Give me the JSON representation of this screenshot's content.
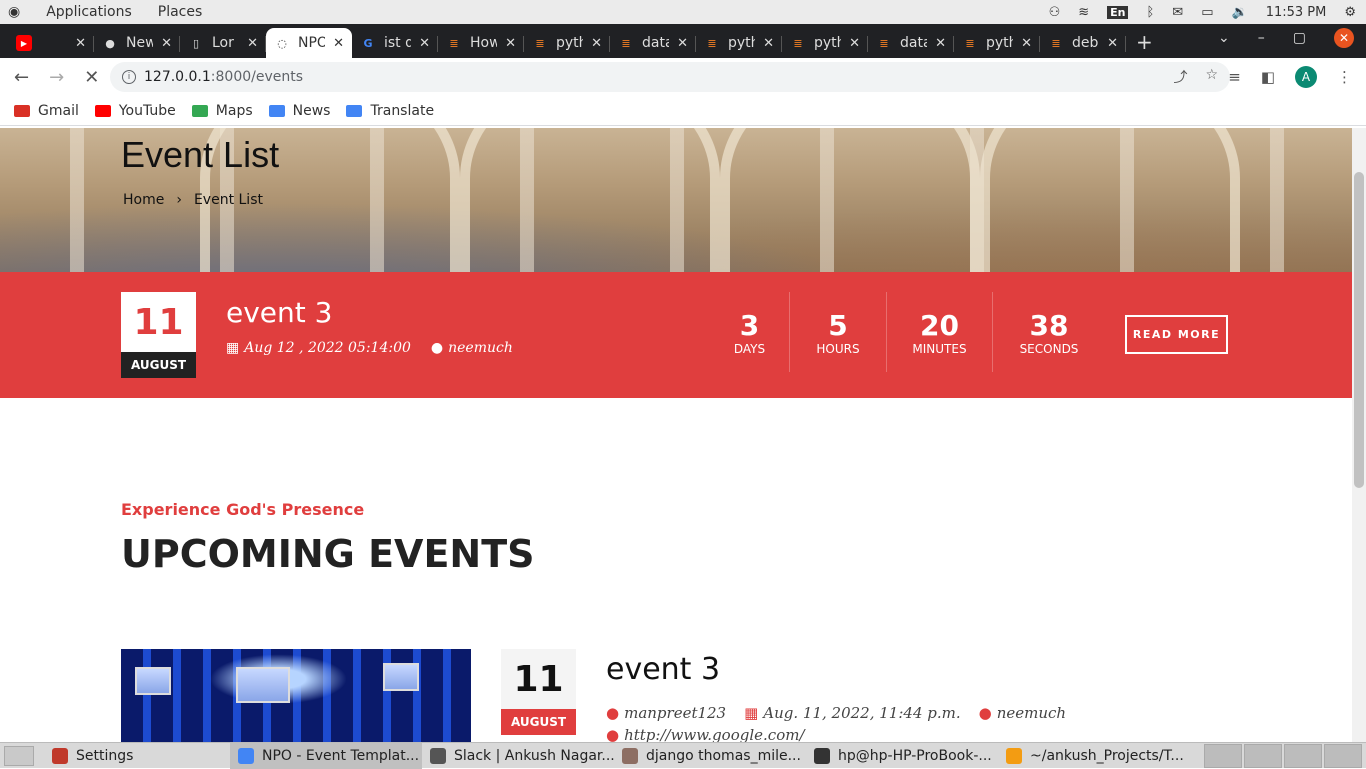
{
  "topbar": {
    "applications": "Applications",
    "places": "Places",
    "lang": "En",
    "time": "11:53 PM"
  },
  "tabs": [
    {
      "title": "",
      "icon": "youtube-icon",
      "color": "#ff0000"
    },
    {
      "title": "New",
      "icon": "github-icon"
    },
    {
      "title": "Lor",
      "icon": "page-icon"
    },
    {
      "title": "NPO",
      "icon": "loading-icon",
      "active": true
    },
    {
      "title": "ist d",
      "icon": "google-icon"
    },
    {
      "title": "How",
      "icon": "stackoverflow-icon"
    },
    {
      "title": "pyth",
      "icon": "stackoverflow-icon"
    },
    {
      "title": "data",
      "icon": "stackoverflow-icon"
    },
    {
      "title": "pyth",
      "icon": "stackoverflow-icon"
    },
    {
      "title": "pyth",
      "icon": "stackoverflow-icon"
    },
    {
      "title": "data",
      "icon": "stackoverflow-icon"
    },
    {
      "title": "pyth",
      "icon": "stackoverflow-icon"
    },
    {
      "title": "deb",
      "icon": "stackoverflow-icon"
    }
  ],
  "url": {
    "host": "127.0.0.1",
    "path": ":8000/events"
  },
  "avatar_letter": "A",
  "bookmarks": [
    {
      "label": "Gmail",
      "color": "#d93025"
    },
    {
      "label": "YouTube",
      "color": "#ff0000"
    },
    {
      "label": "Maps",
      "color": "#34a853"
    },
    {
      "label": "News",
      "color": "#4285f4"
    },
    {
      "label": "Translate",
      "color": "#4285f4"
    }
  ],
  "hero": {
    "title": "Event List",
    "crumb_home": "Home",
    "crumb_sep": "›",
    "crumb_current": "Event List"
  },
  "featured": {
    "day": "11",
    "month": "AUGUST",
    "title": "event 3",
    "date": "Aug 12 , 2022 05:14:00",
    "location": "neemuch",
    "countdown": [
      {
        "value": "3",
        "unit": "DAYS"
      },
      {
        "value": "5",
        "unit": "HOURS"
      },
      {
        "value": "20",
        "unit": "MINUTES"
      },
      {
        "value": "38",
        "unit": "SECONDS"
      }
    ],
    "read_more": "READ MORE"
  },
  "section": {
    "tagline": "Experience God's Presence",
    "heading": "UPCOMING EVENTS"
  },
  "event_card": {
    "day": "11",
    "month": "AUGUST",
    "title": "event 3",
    "author": "manpreet123",
    "date": "Aug. 11, 2022, 11:44 p.m.",
    "location": "neemuch",
    "url": "http://www.google.com/"
  },
  "taskbar": [
    {
      "label": "Settings",
      "color": "#c0392b"
    },
    {
      "label": "NPO - Event Templat...",
      "color": "#4285f4",
      "active": true
    },
    {
      "label": "Slack | Ankush Nagar...",
      "color": "#555"
    },
    {
      "label": "django thomas_mile...",
      "color": "#8d6e63"
    },
    {
      "label": "hp@hp-HP-ProBook-...",
      "color": "#333"
    },
    {
      "label": "~/ankush_Projects/T...",
      "color": "#f39c12"
    }
  ],
  "colors": {
    "accent": "#e03e3e",
    "chrome_dark": "#202124"
  }
}
